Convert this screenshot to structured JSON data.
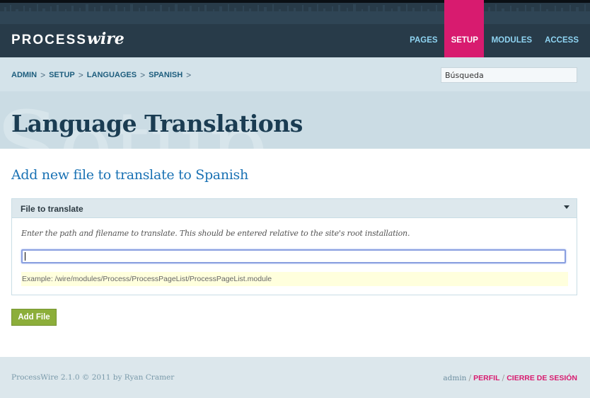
{
  "masthead": {
    "logo_main": "PROCESS",
    "logo_accent": "wire",
    "nav": [
      {
        "label": "PAGES",
        "active": false
      },
      {
        "label": "SETUP",
        "active": true
      },
      {
        "label": "MODULES",
        "active": false
      },
      {
        "label": "ACCESS",
        "active": false
      }
    ]
  },
  "breadcrumbs": [
    "ADMIN",
    "SETUP",
    "LANGUAGES",
    "SPANISH"
  ],
  "breadcrumb_separator": ">",
  "search": {
    "value": "Búsqueda"
  },
  "watermark_text": "Setup",
  "page_title": "Language Translations",
  "main": {
    "heading": "Add new file to translate to Spanish",
    "field": {
      "label": "File to translate",
      "description": "Enter the path and filename to translate. This should be entered relative to the site's root installation.",
      "value": "",
      "note": "Example: /wire/modules/Process/ProcessPageList/ProcessPageList.module"
    },
    "submit_label": "Add File"
  },
  "footer": {
    "copyright": "ProcessWire 2.1.0 © 2011 by Ryan Cramer",
    "username": "admin",
    "profile_label": "PERFIL",
    "logout_label": "CIERRE DE SESIÓN"
  },
  "colors": {
    "masthead": "#283b49",
    "accent": "#d81b6f",
    "nav_link": "#8fd4f2",
    "button": "#8cae3a",
    "heading": "#1a72b4"
  }
}
